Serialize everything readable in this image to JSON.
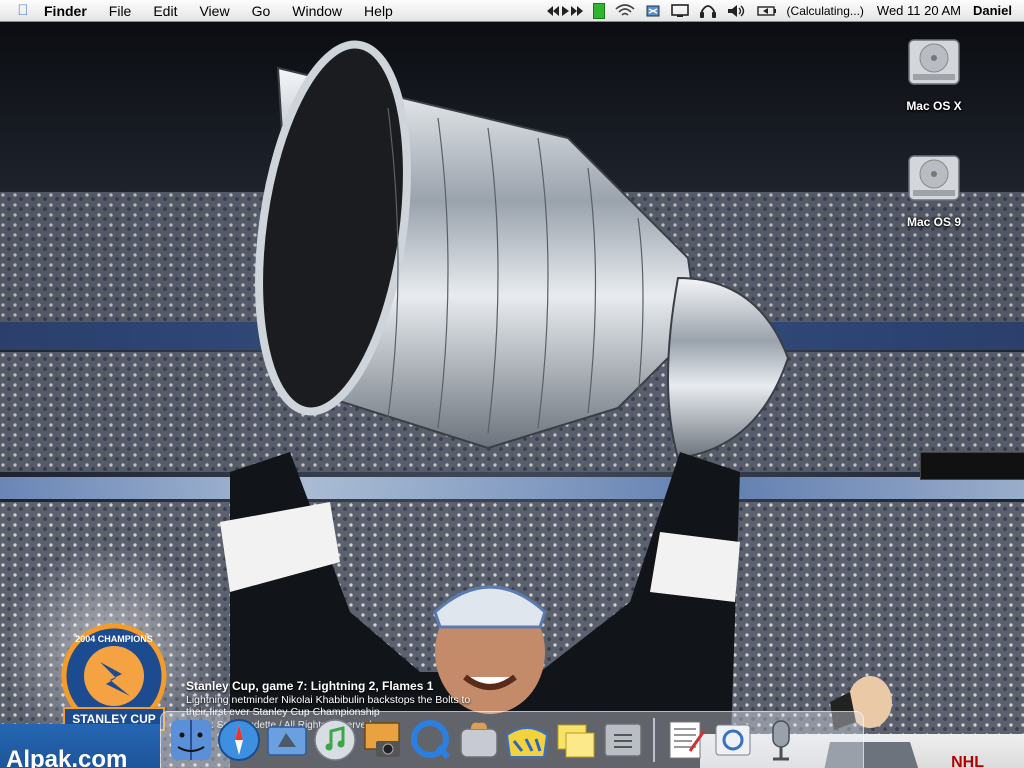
{
  "menubar": {
    "app_name": "Finder",
    "menus": [
      "File",
      "Edit",
      "View",
      "Go",
      "Window",
      "Help"
    ],
    "battery_status": "(Calculating...)",
    "clock": "Wed 11 20 AM",
    "user": "Daniel",
    "extras": [
      "media-controls-icon",
      "battery-level-icon",
      "airport-icon",
      "sync-icon",
      "display-icon",
      "headphones-icon",
      "volume-icon",
      "battery-icon"
    ]
  },
  "desktop": {
    "icons": [
      {
        "label": "Mac OS X",
        "icon": "hard-drive-icon"
      },
      {
        "label": "Mac OS 9",
        "icon": "hard-drive-icon"
      }
    ]
  },
  "wallpaper": {
    "caption_title": "Stanley Cup, game 7: Lightning 2, Flames 1",
    "caption_body": "Lightning netminder Nikolai Khabibulin backstops the Bolts to their first ever Stanley Cup Championship",
    "caption_credit": "photo: Scott Audette / All Rights Reserved",
    "badge_top": "2004 CHAMPIONS",
    "badge_bottom": "STANLEY CUP",
    "ad_text": "Alpak.com",
    "board_text": "NHL"
  },
  "dock": {
    "apps": [
      {
        "name": "Finder",
        "icon": "finder-icon"
      },
      {
        "name": "Safari",
        "icon": "safari-icon"
      },
      {
        "name": "Mail",
        "icon": "mail-icon"
      },
      {
        "name": "iTunes",
        "icon": "itunes-icon"
      },
      {
        "name": "iPhoto",
        "icon": "iphoto-icon"
      },
      {
        "name": "QuickTime",
        "icon": "quicktime-icon"
      },
      {
        "name": "Toast",
        "icon": "toast-icon"
      },
      {
        "name": "Wallpaper",
        "icon": "wallpaper-app-icon"
      },
      {
        "name": "Stickies",
        "icon": "stickies-icon"
      },
      {
        "name": "System Preferences",
        "icon": "system-preferences-icon"
      },
      {
        "name": "TextEdit",
        "icon": "textedit-icon"
      },
      {
        "name": "Mail Document",
        "icon": "mail-document-icon"
      },
      {
        "name": "Microphone",
        "icon": "microphone-icon"
      }
    ]
  },
  "colors": {
    "menubar_bg": "#ececec",
    "accent_blue": "#3a6fc4",
    "battery_green": "#2fb52f"
  }
}
